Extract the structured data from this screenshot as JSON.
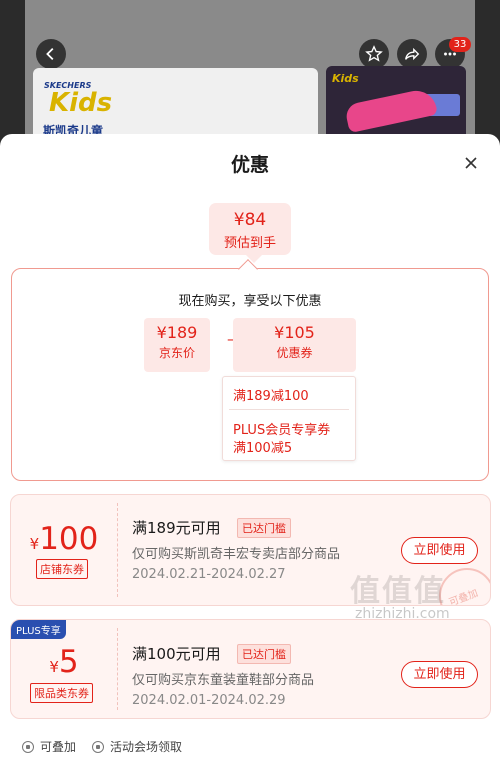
{
  "background": {
    "brand_logo": "SKECHERS",
    "brand_kids": "Kids",
    "brand_name": "斯凯奇儿童",
    "thumb_brand": "Kids",
    "cart_badge": "33"
  },
  "sheet": {
    "title": "优惠"
  },
  "estimate": {
    "price": "¥84",
    "label": "预估到手"
  },
  "breakdown": {
    "title": "现在购买，享受以下优惠",
    "original": {
      "price": "¥189",
      "label": "京东价"
    },
    "minus": "–",
    "coupon": {
      "price": "¥105",
      "label": "优惠券"
    },
    "details": [
      "满189减100",
      "PLUS会员专享券",
      "满100减5"
    ]
  },
  "coupons": [
    {
      "yen": "¥",
      "amount": "100",
      "type": "店铺东券",
      "condition": "满189元可用",
      "reached": "已达门槛",
      "scope": "仅可购买斯凯奇丰宏专卖店部分商品",
      "date": "2024.02.21-2024.02.27",
      "button": "立即使用",
      "stamp": "可叠加"
    },
    {
      "tag": "PLUS专享",
      "yen": "¥",
      "amount": "5",
      "type": "限品类东券",
      "condition": "满100元可用",
      "reached": "已达门槛",
      "scope": "仅可购买京东童装童鞋部分商品",
      "date": "2024.02.01-2024.02.29",
      "button": "立即使用"
    }
  ],
  "legend": {
    "stackable": "可叠加",
    "venue": "活动会场领取"
  },
  "watermark": {
    "text": "值值值",
    "url": "zhizhizhi.com"
  },
  "colors": {
    "accent": "#e2231a",
    "accent_light": "#fde8e6",
    "plus_blue": "#2a4fb0"
  }
}
